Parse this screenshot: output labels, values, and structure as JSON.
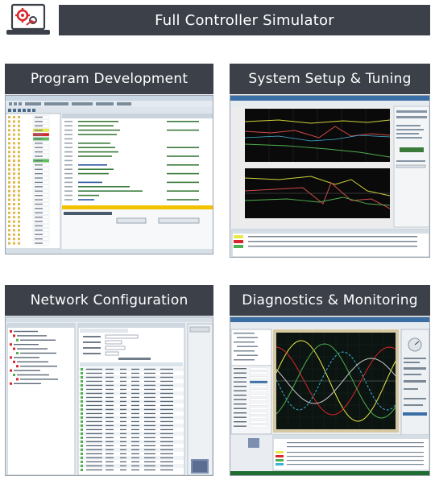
{
  "header": {
    "title": "Full Controller Simulator",
    "icon": "controller-laptop-gear-icon",
    "icon_color": "#d9262c"
  },
  "sections": {
    "program_development": {
      "title": "Program Development",
      "screenshot": "ide-editor-screenshot"
    },
    "system_setup_tuning": {
      "title": "System Setup & Tuning",
      "screenshot": "frequency-response-plot-screenshot"
    },
    "network_configuration": {
      "title": "Network Configuration",
      "screenshot": "network-tree-table-screenshot"
    },
    "diagnostics_monitoring": {
      "title": "Diagnostics & Monitoring",
      "screenshot": "oscilloscope-waveform-screenshot"
    }
  },
  "colors": {
    "bar_bg": "#3b4049",
    "bar_text": "#ffffff",
    "accent_red": "#d9262c",
    "scope_bg": "#0b1410",
    "plot_bg": "#0a0a0a"
  }
}
